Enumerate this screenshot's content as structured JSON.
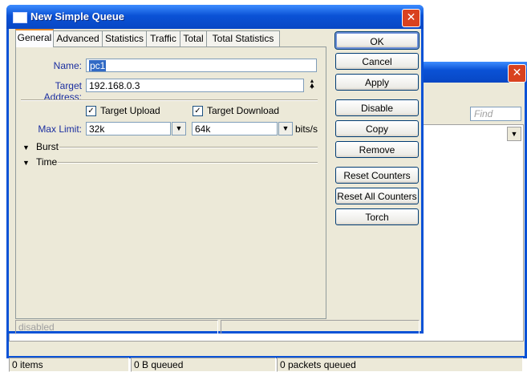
{
  "background_window": {
    "find_placeholder": "Find",
    "status": [
      "0 items",
      "0 B queued",
      "0 packets queued"
    ]
  },
  "dialog": {
    "title": "New Simple Queue",
    "tabs": [
      "General",
      "Advanced",
      "Statistics",
      "Traffic",
      "Total",
      "Total Statistics"
    ],
    "active_tab": "General",
    "form": {
      "name_label": "Name:",
      "name_value": "pc1",
      "target_address_label": "Target Address:",
      "target_address_value": "192.168.0.3",
      "target_upload_label": "Target Upload",
      "target_upload_checked": true,
      "target_download_label": "Target Download",
      "target_download_checked": true,
      "max_limit_label": "Max Limit:",
      "max_limit_upload": "32k",
      "max_limit_download": "64k",
      "max_limit_unit": "bits/s",
      "burst_label": "Burst",
      "time_label": "Time"
    },
    "buttons": {
      "ok": "OK",
      "cancel": "Cancel",
      "apply": "Apply",
      "disable": "Disable",
      "copy": "Copy",
      "remove": "Remove",
      "reset_counters": "Reset Counters",
      "reset_all_counters": "Reset All Counters",
      "torch": "Torch"
    },
    "status_text": "disabled"
  },
  "colors": {
    "titlebar": "#0a52d6",
    "dialog_face": "#ece9d8",
    "label_blue": "#1b2ea0",
    "close_red": "#d9421f"
  }
}
